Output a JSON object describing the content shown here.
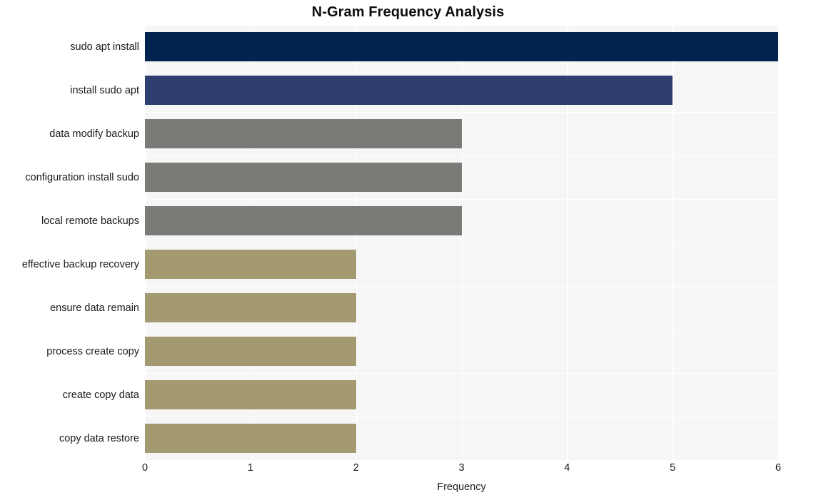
{
  "chart_data": {
    "type": "bar",
    "orientation": "horizontal",
    "title": "N-Gram Frequency Analysis",
    "xlabel": "Frequency",
    "ylabel": "",
    "categories": [
      "sudo apt install",
      "install sudo apt",
      "data modify backup",
      "configuration install sudo",
      "local remote backups",
      "effective backup recovery",
      "ensure data remain",
      "process create copy",
      "create copy data",
      "copy data restore"
    ],
    "values": [
      6,
      5,
      3,
      3,
      3,
      2,
      2,
      2,
      2,
      2
    ],
    "bar_colors": [
      "#022250",
      "#2e3e6e",
      "#7b7a76",
      "#7b7a76",
      "#7b7a76",
      "#a49a72",
      "#a49a72",
      "#a49a72",
      "#a49a72",
      "#a49a72"
    ],
    "xlim": [
      0,
      6.0
    ],
    "xticks": [
      0,
      1,
      2,
      3,
      4,
      5,
      6
    ],
    "xticklabels": [
      "0",
      "1",
      "2",
      "3",
      "4",
      "5",
      "6"
    ],
    "grid": true,
    "grid_color": "#ffffff",
    "plot_background": "#f6f6f7",
    "figure_background": "#ffffff",
    "legend": null
  },
  "style": {
    "title_color": "#0d0d0d",
    "tick_label_color": "#1a1a1a"
  }
}
